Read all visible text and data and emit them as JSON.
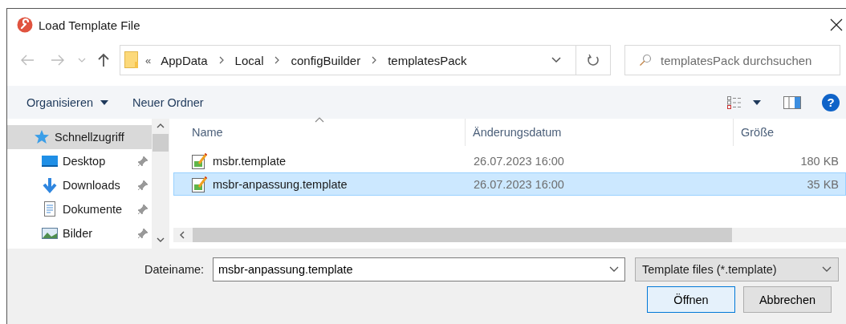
{
  "window": {
    "title": "Load Template File"
  },
  "navigation": {
    "overflow": "«",
    "path": [
      "AppData",
      "Local",
      "configBuilder",
      "templatesPack"
    ],
    "search": {
      "placeholder": "templatesPack durchsuchen"
    }
  },
  "toolbar": {
    "organize": "Organisieren",
    "new_folder": "Neuer Ordner",
    "help": "?"
  },
  "sidebar": {
    "items": [
      {
        "label": "Schnellzugriff",
        "kind": "star",
        "selected": true,
        "pinned": false,
        "children": [
          {
            "label": "Desktop",
            "kind": "desktop",
            "selected": false,
            "pinned": true
          },
          {
            "label": "Downloads",
            "kind": "download",
            "selected": false,
            "pinned": true
          },
          {
            "label": "Dokumente",
            "kind": "document",
            "selected": false,
            "pinned": true
          },
          {
            "label": "Bilder",
            "kind": "image",
            "selected": false,
            "pinned": true
          }
        ]
      }
    ]
  },
  "file_list": {
    "columns": [
      {
        "label": "Name",
        "sorted": true
      },
      {
        "label": "Änderungsdatum",
        "sorted": false
      },
      {
        "label": "Größe",
        "sorted": false
      }
    ],
    "rows": [
      {
        "name": "msbr.template",
        "modified": "26.07.2023 16:00",
        "size": "180 KB",
        "selected": false
      },
      {
        "name": "msbr-anpassung.template",
        "modified": "26.07.2023 16:00",
        "size": "35 KB",
        "selected": true
      }
    ]
  },
  "filename": {
    "label": "Dateiname:",
    "value": "msbr-anpassung.template"
  },
  "file_type": {
    "value": "Template files (*.template)"
  },
  "buttons": [
    {
      "label": "Öffnen",
      "default": true
    },
    {
      "label": "Abbrechen",
      "default": false
    }
  ]
}
